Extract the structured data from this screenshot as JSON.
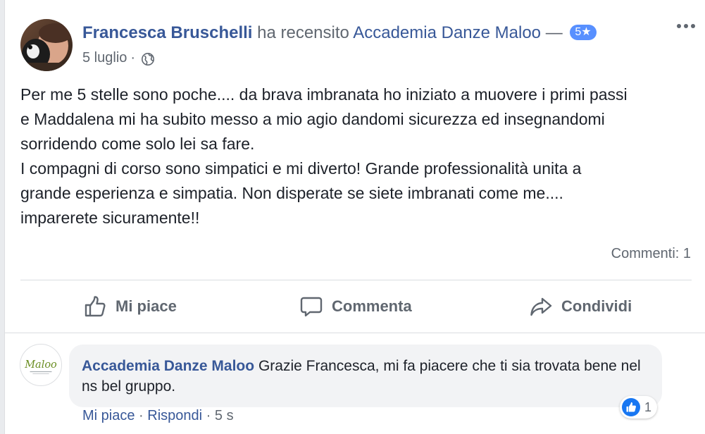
{
  "post": {
    "author": "Francesca Bruschelli",
    "verb": "ha recensito",
    "page": "Accademia Danze Maloo",
    "dash": "—",
    "rating": "5★",
    "date": "5 luglio",
    "date_sep": "·",
    "privacy_icon": "globe-icon",
    "text_lines": [
      "Per me 5 stelle sono poche.... da brava imbranata ho iniziato a muovere i primi passi",
      "e Maddalena mi ha subito messo a mio agio dandomi sicurezza ed insegnandomi",
      "sorridendo come solo lei sa fare.",
      "I compagni di corso sono simpatici e mi diverto! Grande professionalità unita a",
      "grande esperienza e simpatia. Non disperate se siete imbranati come me....",
      "imparerete sicuramente!!"
    ],
    "comments_count": "Commenti: 1"
  },
  "actions": {
    "like": "Mi piace",
    "comment": "Commenta",
    "share": "Condividi"
  },
  "comment": {
    "author": "Accademia Danze Maloo",
    "text": "Grazie Francesca, mi fa piacere che ti sia trovata bene nel ns bel gruppo.",
    "like": "Mi piace",
    "sep1": "·",
    "reply": "Rispondi",
    "sep2": "·",
    "time": "5 s",
    "reaction_count": "1",
    "avatar_logo_text": "Maloo"
  },
  "colors": {
    "link": "#385898",
    "muted": "#606770",
    "badge": "#5890ff",
    "like_blue": "#1877f2"
  }
}
